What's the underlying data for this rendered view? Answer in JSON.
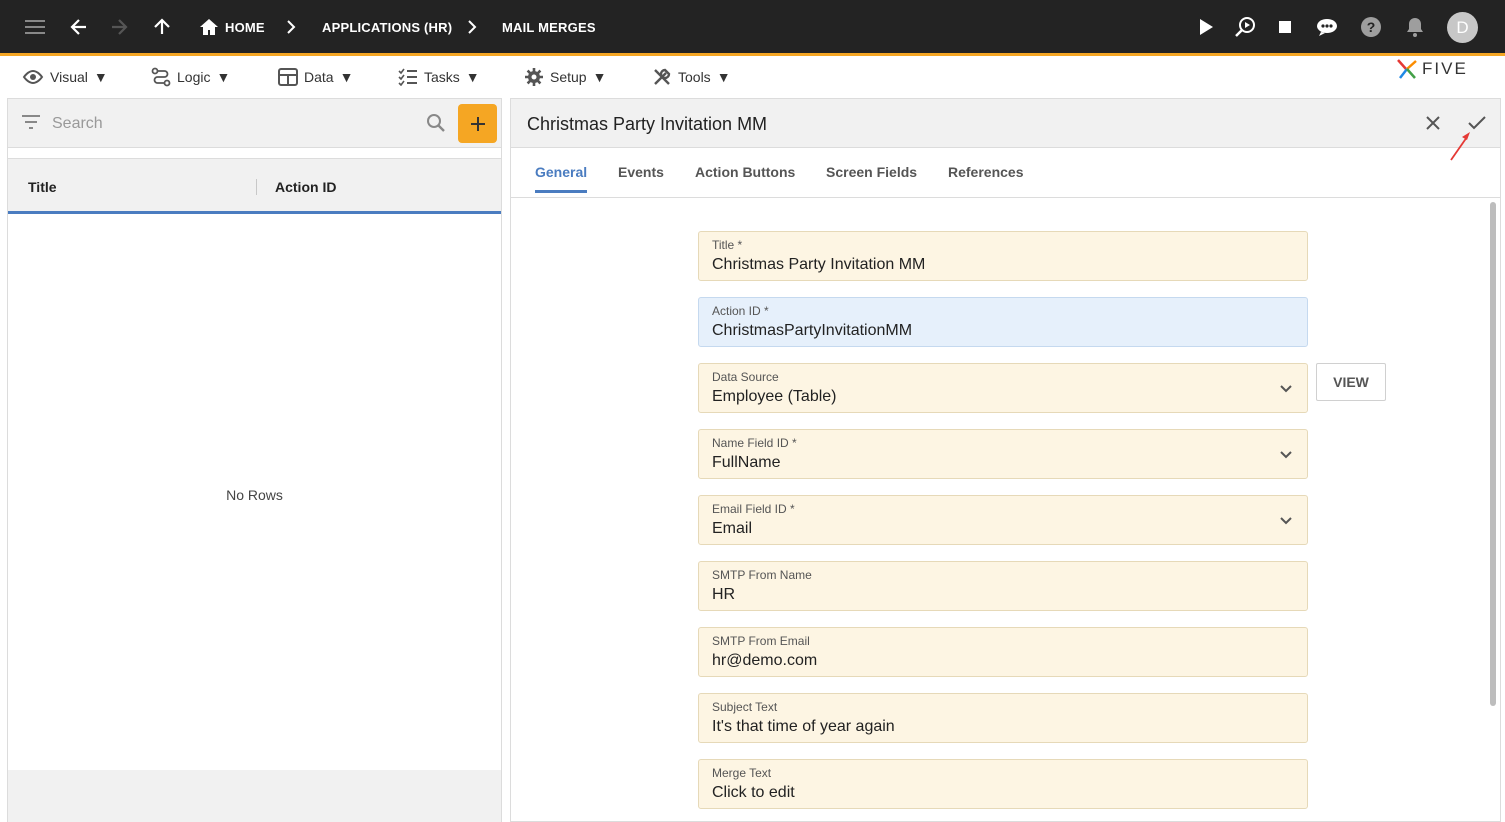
{
  "topbar": {
    "breadcrumbs": [
      "HOME",
      "APPLICATIONS (HR)",
      "MAIL MERGES"
    ],
    "avatar_initial": "D"
  },
  "menu": {
    "items": [
      {
        "label": "Visual",
        "icon": "eye-icon"
      },
      {
        "label": "Logic",
        "icon": "logic-icon"
      },
      {
        "label": "Data",
        "icon": "table-icon"
      },
      {
        "label": "Tasks",
        "icon": "tasks-icon"
      },
      {
        "label": "Setup",
        "icon": "gear-icon"
      },
      {
        "label": "Tools",
        "icon": "tools-icon"
      }
    ],
    "logo_text": "FIVE"
  },
  "left_panel": {
    "search_placeholder": "Search",
    "columns": [
      "Title",
      "Action ID"
    ],
    "empty_text": "No Rows"
  },
  "form": {
    "title": "Christmas Party Invitation MM",
    "tabs": [
      "General",
      "Events",
      "Action Buttons",
      "Screen Fields",
      "References"
    ],
    "active_tab": "General",
    "view_button": "VIEW",
    "fields": [
      {
        "label": "Title *",
        "value": "Christmas Party Invitation MM",
        "dropdown": false
      },
      {
        "label": "Action ID *",
        "value": "ChristmasPartyInvitationMM",
        "dropdown": false
      },
      {
        "label": "Data Source",
        "value": "Employee (Table)",
        "dropdown": true
      },
      {
        "label": "Name Field ID *",
        "value": "FullName",
        "dropdown": true
      },
      {
        "label": "Email Field ID *",
        "value": "Email",
        "dropdown": true
      },
      {
        "label": "SMTP From Name",
        "value": "HR",
        "dropdown": false
      },
      {
        "label": "SMTP From Email",
        "value": "hr@demo.com",
        "dropdown": false
      },
      {
        "label": "Subject Text",
        "value": "It's that time of year again",
        "dropdown": false
      },
      {
        "label": "Merge Text",
        "value": "Click to edit",
        "dropdown": false
      }
    ]
  },
  "colors": {
    "accent": "#f5a623",
    "tab_active": "#4a7cc0",
    "field_bg": "#fdf5e3",
    "field_focus_bg": "#e6f0fb",
    "topbar_bg": "#232323"
  }
}
